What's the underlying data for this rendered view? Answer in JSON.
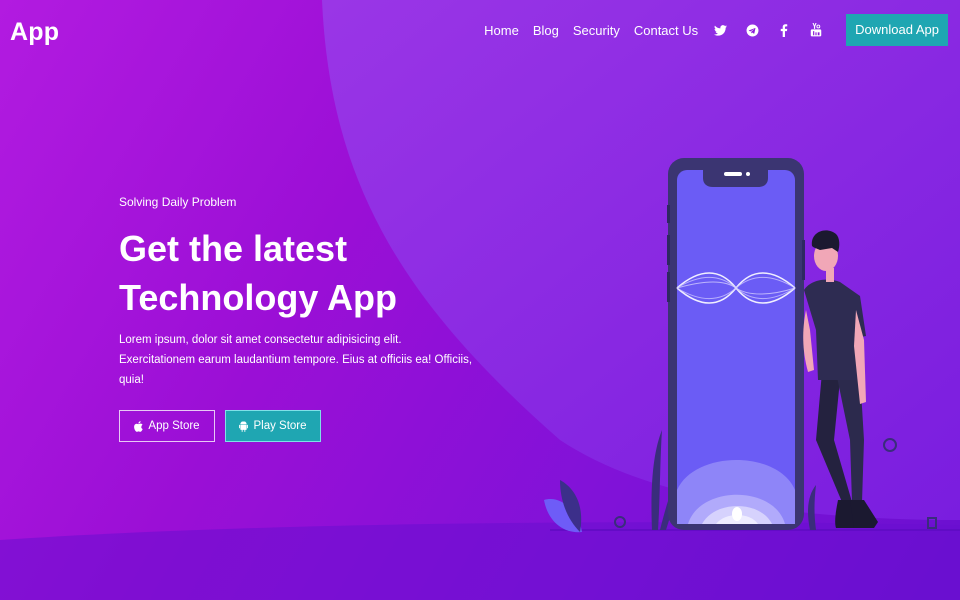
{
  "header": {
    "logo": "App",
    "nav": [
      {
        "label": "Home"
      },
      {
        "label": "Blog"
      },
      {
        "label": "Security"
      },
      {
        "label": "Contact Us"
      }
    ],
    "social_icons": [
      "twitter-icon",
      "telegram-icon",
      "facebook-icon",
      "youtube-icon"
    ],
    "download_label": "Download App"
  },
  "hero": {
    "kicker": "Solving Daily Problem",
    "title_line1": "Get the latest",
    "title_line2": "Technology App",
    "description": "Lorem ipsum, dolor sit amet consectetur adipisicing elit. Exercitationem earum laudantium tempore. Eius at officiis ea! Officiis, quia!",
    "app_store_label": "App Store",
    "play_store_label": "Play Store"
  },
  "colors": {
    "accent": "#1fa6b2",
    "background_start": "#b21be0",
    "background_end": "#6a10d0",
    "phone_screen": "#6b5cf5"
  }
}
